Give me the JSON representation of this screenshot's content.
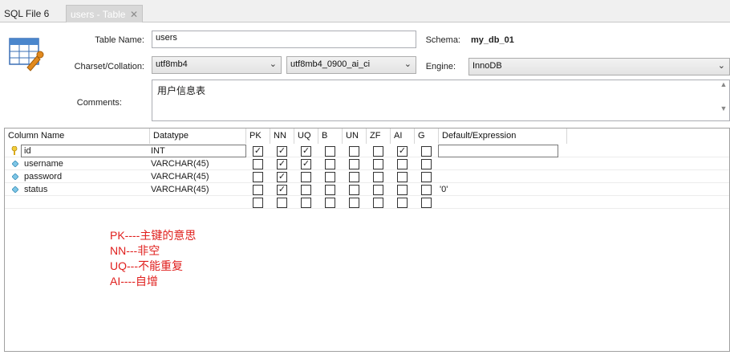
{
  "tabs": {
    "sql_file": "SQL File 6",
    "active": "users - Table",
    "close_glyph": "✕"
  },
  "form": {
    "table_name_label": "Table Name:",
    "table_name_value": "users",
    "schema_label": "Schema:",
    "schema_value": "my_db_01",
    "charset_label": "Charset/Collation:",
    "charset_value": "utf8mb4",
    "collation_value": "utf8mb4_0900_ai_ci",
    "engine_label": "Engine:",
    "engine_value": "InnoDB",
    "comments_label": "Comments:",
    "comments_value": "用户信息表"
  },
  "grid": {
    "headers": [
      "Column Name",
      "Datatype",
      "PK",
      "NN",
      "UQ",
      "B",
      "UN",
      "ZF",
      "AI",
      "G",
      "Default/Expression"
    ],
    "rows": [
      {
        "name": "id",
        "type": "INT",
        "flags": [
          true,
          true,
          true,
          false,
          false,
          false,
          true,
          false
        ],
        "default": "",
        "icon": "key-icon"
      },
      {
        "name": "username",
        "type": "VARCHAR(45)",
        "flags": [
          false,
          true,
          true,
          false,
          false,
          false,
          false,
          false
        ],
        "default": "",
        "icon": "column-diamond-icon"
      },
      {
        "name": "password",
        "type": "VARCHAR(45)",
        "flags": [
          false,
          true,
          false,
          false,
          false,
          false,
          false,
          false
        ],
        "default": "",
        "icon": "column-diamond-icon"
      },
      {
        "name": "status",
        "type": "VARCHAR(45)",
        "flags": [
          false,
          true,
          false,
          false,
          false,
          false,
          false,
          false
        ],
        "default": "'0'",
        "icon": "column-diamond-icon"
      }
    ],
    "check_glyph": "✓"
  },
  "annotations": [
    "PK----主键的意思",
    "NN---非空",
    "UQ---不能重复",
    "AI----自增"
  ],
  "colors": {
    "annotation_text": "#e0201e",
    "tab_active_bg": "#d8d8d8"
  }
}
